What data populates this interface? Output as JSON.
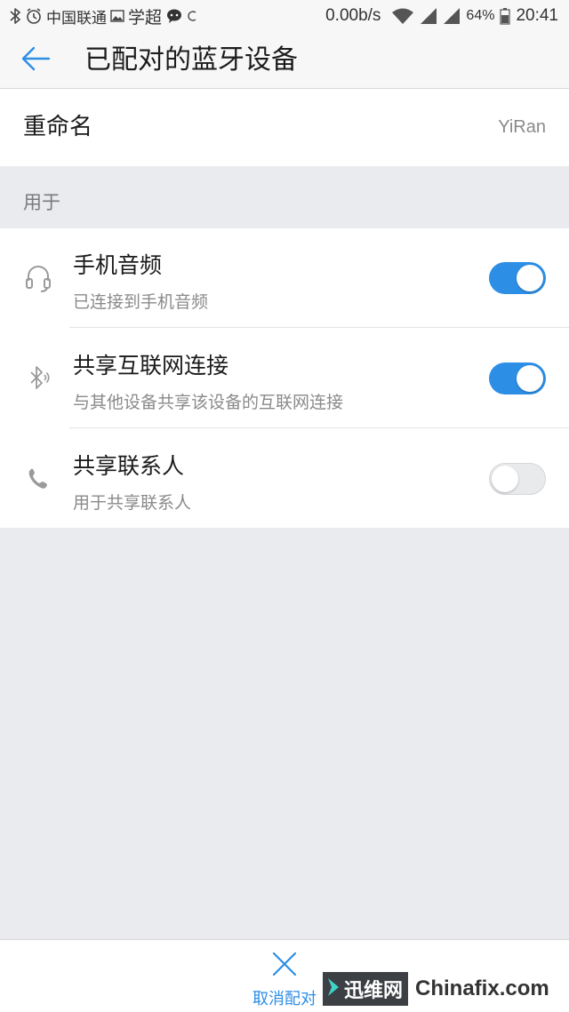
{
  "status_bar": {
    "carrier": "中国联通",
    "app_name": "学超",
    "net_speed": "0.00b/s",
    "battery": "64%",
    "time": "20:41"
  },
  "app_bar": {
    "title": "已配对的蓝牙设备"
  },
  "rename": {
    "label": "重命名",
    "value": "YiRan"
  },
  "section": {
    "label": "用于"
  },
  "settings": [
    {
      "icon": "headset-icon",
      "title": "手机音频",
      "subtitle": "已连接到手机音频",
      "enabled": true
    },
    {
      "icon": "bluetooth-icon",
      "title": "共享互联网连接",
      "subtitle": "与其他设备共享该设备的互联网连接",
      "enabled": true
    },
    {
      "icon": "phone-icon",
      "title": "共享联系人",
      "subtitle": "用于共享联系人",
      "enabled": false
    }
  ],
  "bottom_bar": {
    "unpair_label": "取消配对"
  },
  "watermark": {
    "left_text": "迅维网",
    "right_text": "Chinafix.com"
  },
  "colors": {
    "accent": "#2d8ee6",
    "background": "#e9ebee",
    "toggle_off": "#e8eaec"
  }
}
